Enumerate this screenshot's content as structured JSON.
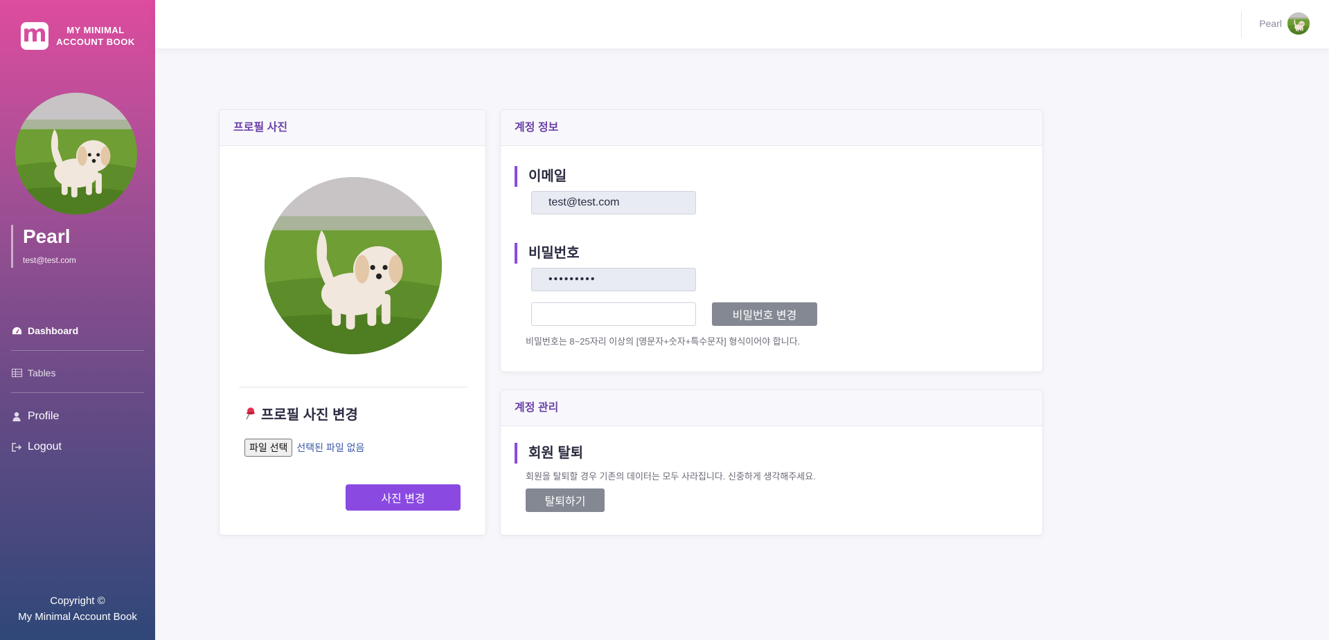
{
  "sidebar": {
    "brand_logo": "m",
    "brand_title": "MY MINIMAL ACCOUNT BOOK",
    "user_name": "Pearl",
    "user_email": "test@test.com",
    "nav": [
      {
        "label": "Dashboard",
        "icon": "gauge-icon"
      },
      {
        "label": "Tables",
        "icon": "table-icon"
      },
      {
        "label": "Profile",
        "icon": "user-icon"
      },
      {
        "label": "Logout",
        "icon": "logout-icon"
      }
    ],
    "copyright_line1": "Copyright ©",
    "copyright_line2": "My Minimal Account Book"
  },
  "topbar": {
    "user_name": "Pearl"
  },
  "profile_photo_card": {
    "header": "프로필 사진",
    "change_title": "프로필 사진 변경",
    "file_button": "파일 선택",
    "file_status": "선택된 파일 없음",
    "submit_label": "사진 변경"
  },
  "account_info_card": {
    "header": "계정 정보",
    "email_title": "이메일",
    "email_value": "test@test.com",
    "password_title": "비밀번호",
    "password_value": "•••••••••",
    "new_password_value": "",
    "change_password_button": "비밀번호 변경",
    "password_hint": "비밀번호는 8~25자리 이상의 [영문자+숫자+특수문자] 형식이어야 합니다."
  },
  "account_manage_card": {
    "header": "계정 관리",
    "withdraw_title": "회원 탈퇴",
    "withdraw_desc": "회원을 탈퇴할 경우 기존의 데이터는 모두 사라집니다. 신중하게 생각해주세요.",
    "withdraw_button": "탈퇴하기"
  },
  "colors": {
    "sidebar_top": "#de4c9e",
    "sidebar_bottom": "#2f4778",
    "accent": "#8a4ae2",
    "grey_button": "#848892"
  }
}
